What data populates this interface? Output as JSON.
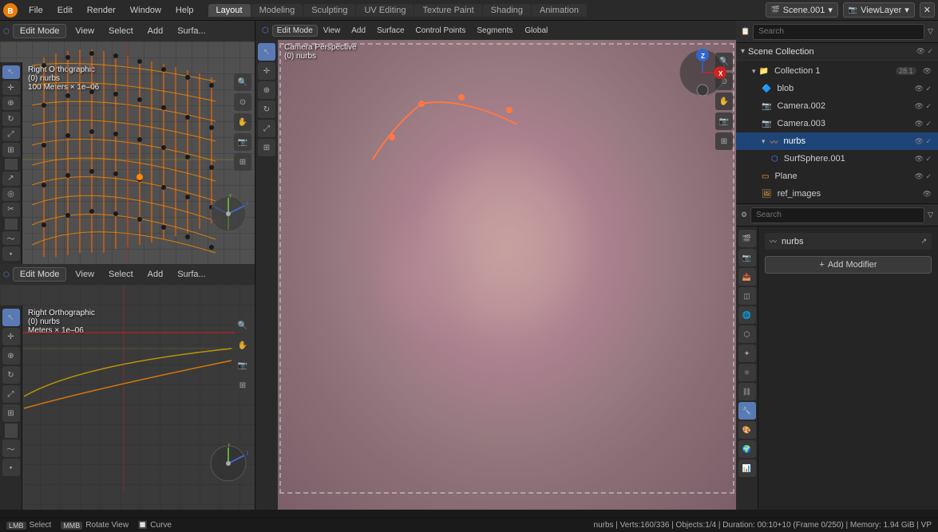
{
  "topMenu": {
    "menus": [
      "File",
      "Edit",
      "Render",
      "Window",
      "Help"
    ],
    "workspaces": [
      "Layout",
      "Modeling",
      "Sculpting",
      "UV Editing",
      "Texture Paint",
      "Shading",
      "Animation"
    ],
    "activeWorkspace": "Layout",
    "sceneLabel": "Scene.001",
    "viewLayerLabel": "ViewLayer"
  },
  "leftPanels": {
    "panel1": {
      "mode": "Edit Mode",
      "viewLabel": "Right Orthographic",
      "subLabel": "(0) nurbs",
      "scaleLabel": "100 Meters × 1e–06"
    },
    "panel2": {
      "mode": "Edit Mode",
      "viewLabel": "Right Orthographic",
      "subLabel": "(0) nurbs",
      "scaleLabel": "Meters × 1e–06"
    }
  },
  "centerViewport": {
    "label": "Camera Perspective",
    "subLabel": "(0) nurbs",
    "axisBtns": [
      "View",
      "Add",
      "Surface",
      "Control Points",
      "Segments"
    ],
    "globalLabel": "Global"
  },
  "outliner": {
    "searchPlaceholder": "Search",
    "title": "Scene Collection",
    "items": [
      {
        "label": "Collection 1",
        "count": "28.1",
        "type": "collection",
        "indent": 0
      },
      {
        "label": "blob",
        "type": "object",
        "indent": 1
      },
      {
        "label": "Camera.002",
        "type": "camera",
        "indent": 1
      },
      {
        "label": "Camera.003",
        "type": "camera",
        "indent": 1
      },
      {
        "label": "nurbs",
        "type": "mesh",
        "indent": 1,
        "active": true
      },
      {
        "label": "SurfSphere.001",
        "type": "mesh",
        "indent": 2
      },
      {
        "label": "Plane",
        "type": "mesh",
        "indent": 1
      },
      {
        "label": "ref_images",
        "type": "object",
        "indent": 1
      }
    ]
  },
  "properties": {
    "searchPlaceholder": "Search",
    "objectName": "nurbs",
    "addModifierLabel": "Add Modifier",
    "icons": [
      "scene",
      "render",
      "output",
      "view-layer",
      "scene-obj",
      "object",
      "particles",
      "physics",
      "constraints",
      "data",
      "shading",
      "world",
      "object-data",
      "modifier"
    ]
  },
  "statusBar": {
    "selectLabel": "Select",
    "rotatLabel": "Rotate View",
    "curveLabel": "Curve",
    "statsLabel": "nurbs | Verts:160/336 | Objects:1/4 | Duration: 00:10+10 (Frame 0/250) | Memory: 1.94 GiB | VP"
  }
}
